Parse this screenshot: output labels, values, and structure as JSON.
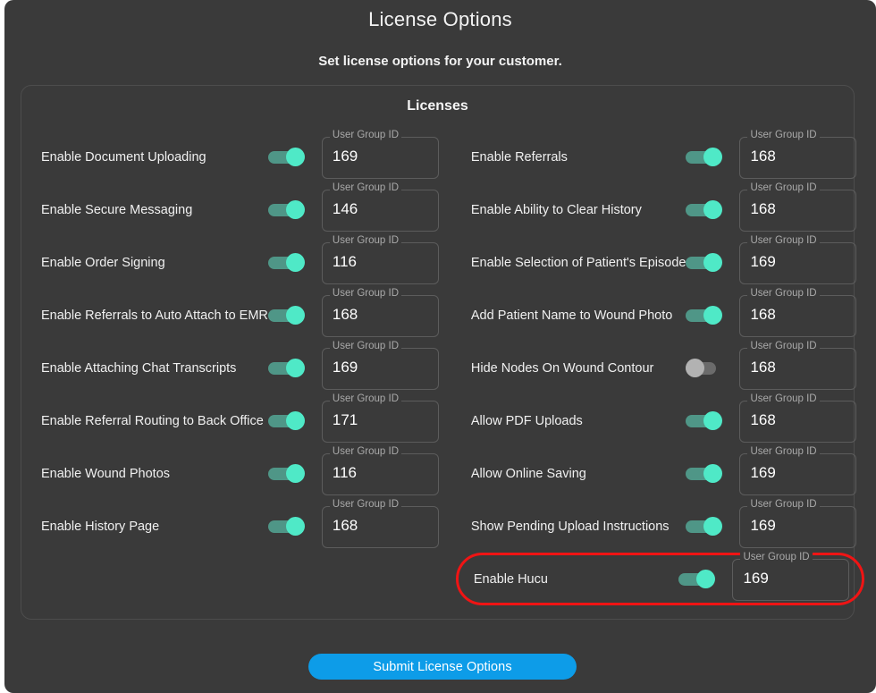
{
  "dialog": {
    "title": "License Options",
    "subtitle": "Set license options for your customer."
  },
  "card": {
    "title": "Licenses"
  },
  "field_label": "User Group ID",
  "rows": [
    {
      "label": "Enable Document Uploading",
      "enabled": true,
      "user_group_id": "169",
      "highlighted": false
    },
    {
      "label": "Enable Referrals",
      "enabled": true,
      "user_group_id": "168",
      "highlighted": false
    },
    {
      "label": "Enable Secure Messaging",
      "enabled": true,
      "user_group_id": "146",
      "highlighted": false
    },
    {
      "label": "Enable Ability to Clear History",
      "enabled": true,
      "user_group_id": "168",
      "highlighted": false
    },
    {
      "label": "Enable Order Signing",
      "enabled": true,
      "user_group_id": "116",
      "highlighted": false
    },
    {
      "label": "Enable Selection of Patient's Episode",
      "enabled": true,
      "user_group_id": "169",
      "highlighted": false
    },
    {
      "label": "Enable Referrals to Auto Attach to EMR",
      "enabled": true,
      "user_group_id": "168",
      "highlighted": false
    },
    {
      "label": "Add Patient Name to Wound Photo",
      "enabled": true,
      "user_group_id": "168",
      "highlighted": false
    },
    {
      "label": "Enable Attaching Chat Transcripts",
      "enabled": true,
      "user_group_id": "169",
      "highlighted": false
    },
    {
      "label": "Hide Nodes On Wound Contour",
      "enabled": false,
      "user_group_id": "168",
      "highlighted": false
    },
    {
      "label": "Enable Referral Routing to Back Office",
      "enabled": true,
      "user_group_id": "171",
      "highlighted": false
    },
    {
      "label": "Allow PDF Uploads",
      "enabled": true,
      "user_group_id": "168",
      "highlighted": false
    },
    {
      "label": "Enable Wound Photos",
      "enabled": true,
      "user_group_id": "116",
      "highlighted": false
    },
    {
      "label": "Allow Online Saving",
      "enabled": true,
      "user_group_id": "169",
      "highlighted": false
    },
    {
      "label": "Enable History Page",
      "enabled": true,
      "user_group_id": "168",
      "highlighted": false
    },
    {
      "label": "Show Pending Upload Instructions",
      "enabled": true,
      "user_group_id": "169",
      "highlighted": false
    },
    {
      "label": "",
      "enabled": null,
      "user_group_id": "",
      "highlighted": false,
      "empty": true
    },
    {
      "label": "Enable Hucu",
      "enabled": true,
      "user_group_id": "169",
      "highlighted": true
    }
  ],
  "footer": {
    "submit_label": "Submit License Options"
  },
  "colors": {
    "dialog_background": "#3a3a3a",
    "toggle_on_track": "#4f9687",
    "toggle_on_knob": "#4fe9c7",
    "toggle_off_track": "#6b6b6b",
    "toggle_off_knob": "#b2b2b2",
    "submit_button": "#0d9ce8",
    "highlight_outline": "#f01414",
    "field_border": "#5c5c5c",
    "field_label": "#a9a9a9"
  }
}
